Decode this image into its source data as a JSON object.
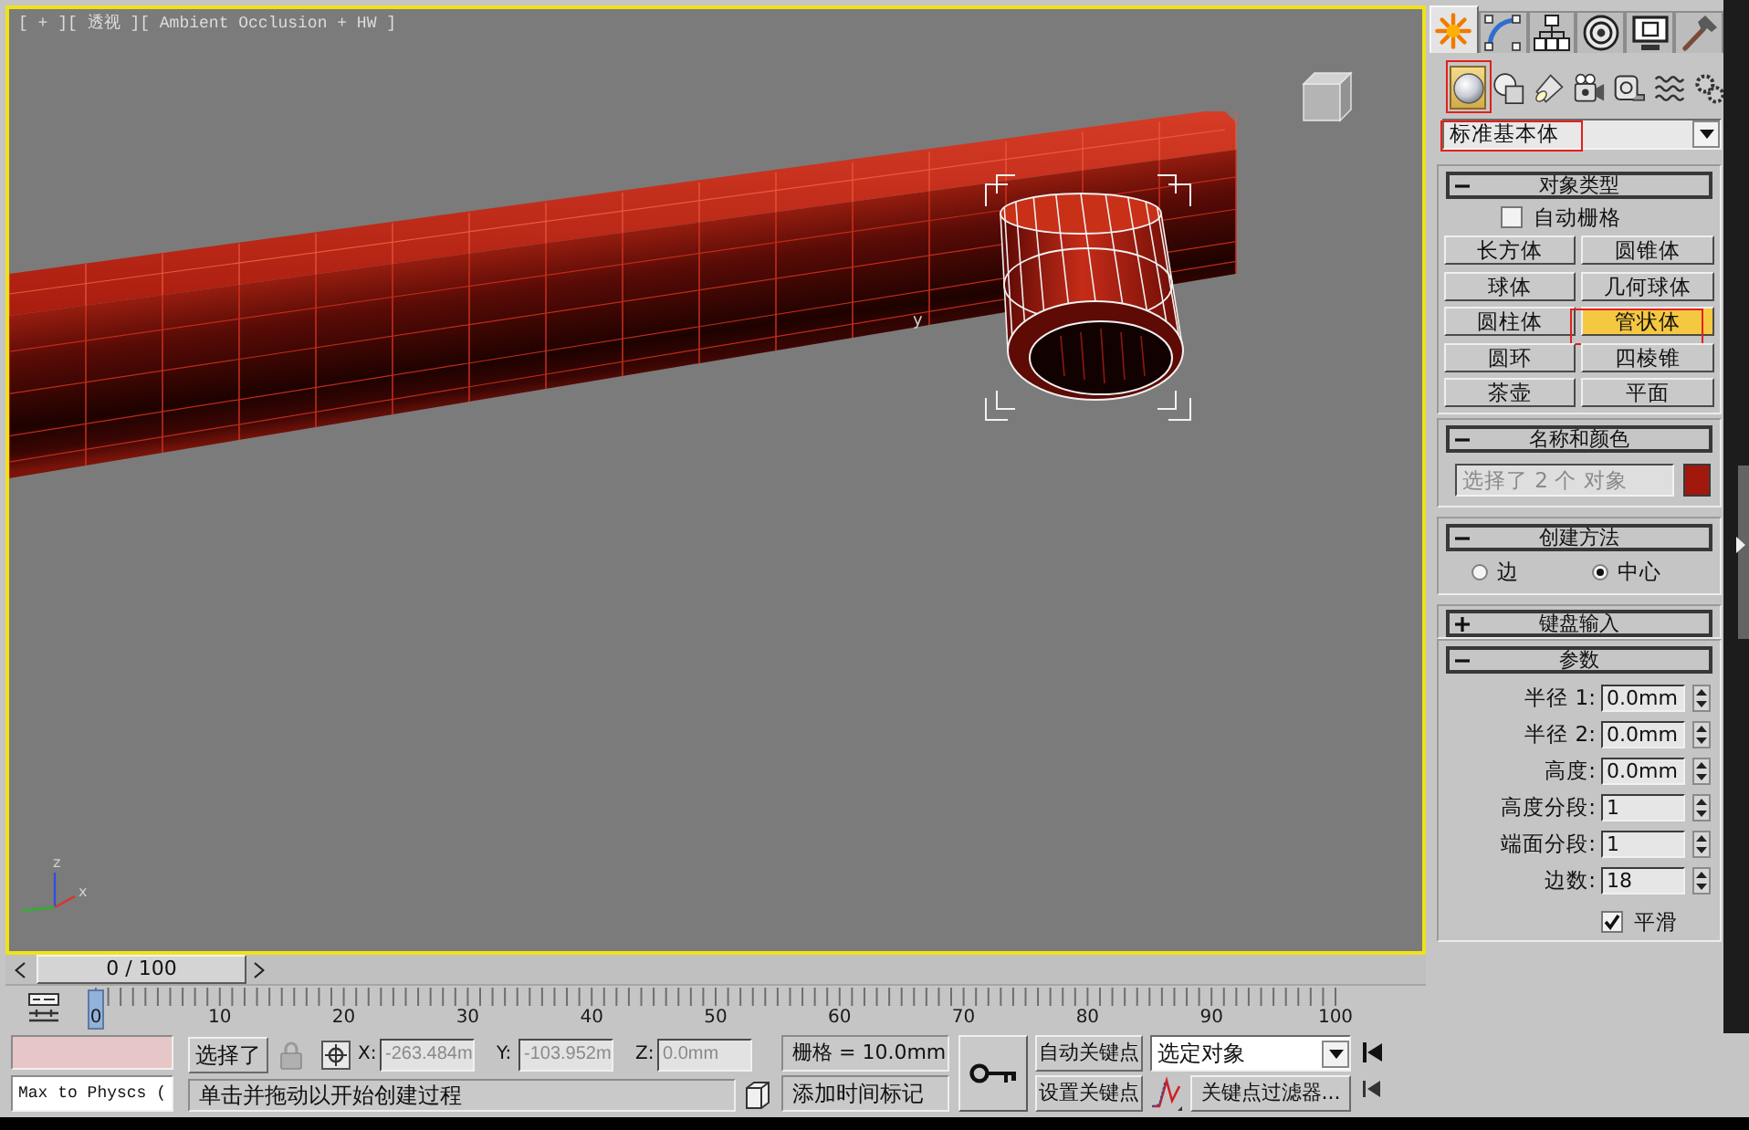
{
  "viewport": {
    "label": "[ + ][ 透视 ][ Ambient Occlusion + HW ]",
    "active": true,
    "gizmo_label": "y",
    "axis_labels": [
      "z",
      "x"
    ]
  },
  "command_panel": {
    "tabs": [
      {
        "kind": "sun",
        "selected": true
      },
      {
        "kind": "arc",
        "selected": false
      },
      {
        "kind": "hierarchy",
        "selected": false
      },
      {
        "kind": "disc",
        "selected": false
      },
      {
        "kind": "monitor",
        "selected": false
      },
      {
        "kind": "hammer",
        "selected": false
      }
    ],
    "categories": [
      {
        "kind": "sphere",
        "selected": true,
        "marked": true
      },
      {
        "kind": "shapes",
        "selected": false,
        "marked": false
      },
      {
        "kind": "lamp",
        "selected": false,
        "marked": false
      },
      {
        "kind": "camera",
        "selected": false,
        "marked": false
      },
      {
        "kind": "tape",
        "selected": false,
        "marked": false
      },
      {
        "kind": "waves",
        "selected": false,
        "marked": false
      },
      {
        "kind": "gears",
        "selected": false,
        "marked": false
      }
    ],
    "object_class": {
      "value": "标准基本体",
      "marked": true
    },
    "rollouts": [
      {
        "kind": "object_type",
        "title": "对象类型",
        "expanded": true,
        "autogrid": {
          "label": "自动栅格",
          "checked": false
        },
        "buttons": [
          {
            "label": "长方体",
            "selected": false,
            "marked": false
          },
          {
            "label": "圆锥体",
            "selected": false,
            "marked": false
          },
          {
            "label": "球体",
            "selected": false,
            "marked": false
          },
          {
            "label": "几何球体",
            "selected": false,
            "marked": false
          },
          {
            "label": "圆柱体",
            "selected": false,
            "marked": false
          },
          {
            "label": "管状体",
            "selected": true,
            "marked": true
          },
          {
            "label": "圆环",
            "selected": false,
            "marked": false
          },
          {
            "label": "四棱锥",
            "selected": false,
            "marked": false
          },
          {
            "label": "茶壶",
            "selected": false,
            "marked": false
          },
          {
            "label": "平面",
            "selected": false,
            "marked": false
          }
        ]
      },
      {
        "kind": "name_color",
        "title": "名称和颜色",
        "expanded": true,
        "name_field": {
          "value": "选择了 2 个 对象",
          "disabled": true
        },
        "color": "#a3180c"
      },
      {
        "kind": "creation_method",
        "title": "创建方法",
        "expanded": true,
        "options": [
          {
            "label": "边",
            "selected": false
          },
          {
            "label": "中心",
            "selected": true
          }
        ]
      },
      {
        "kind": "keyboard_entry",
        "title": "键盘输入",
        "expanded": false
      },
      {
        "kind": "parameters",
        "title": "参数",
        "expanded": true,
        "groups": [
          [
            {
              "label": "半径 1:",
              "value": "0.0mm"
            },
            {
              "label": "半径 2:",
              "value": "0.0mm"
            },
            {
              "label": "高度:",
              "value": "0.0mm"
            }
          ],
          [
            {
              "label": "高度分段:",
              "value": "1"
            },
            {
              "label": "端面分段:",
              "value": "1"
            },
            {
              "label": "边数:",
              "value": "18"
            }
          ]
        ],
        "smooth": {
          "label": "平滑",
          "checked": true
        }
      }
    ]
  },
  "timeline": {
    "slider_label": "0 / 100",
    "level": 0,
    "ruler_labels": [
      "0",
      "10",
      "20",
      "30",
      "40",
      "50",
      "60",
      "70",
      "80",
      "90",
      "100"
    ]
  },
  "status_bar": {
    "listener_value": "Max to Physcs (",
    "selection": "选择了",
    "coordinates": [
      {
        "axis": "X:",
        "value": "-263.484m"
      },
      {
        "axis": "Y:",
        "value": "-103.952m"
      },
      {
        "axis": "Z:",
        "value": "0.0mm"
      }
    ],
    "grid": "栅格 = 10.0mm",
    "prompt": "单击并拖动以开始创建过程",
    "time_tag": "添加时间标记",
    "auto_key": "自动关键点",
    "set_key": "设置关键点",
    "key_set": "选定对象",
    "key_filters": "关键点过滤器..."
  }
}
